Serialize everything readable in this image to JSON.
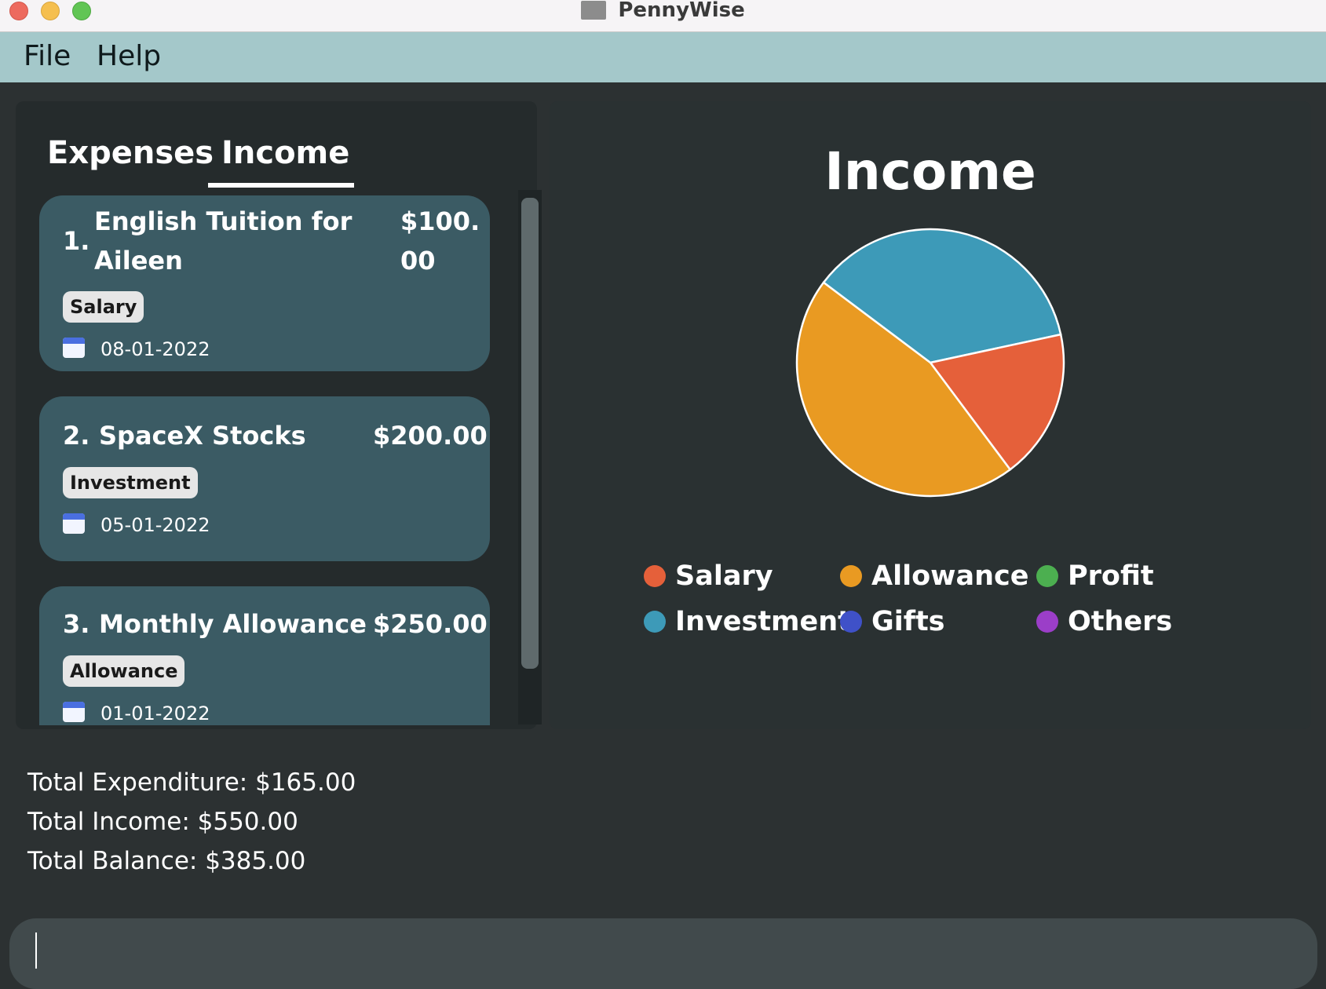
{
  "window": {
    "title": "PennyWise"
  },
  "menu": {
    "file": "File",
    "help": "Help"
  },
  "tabs": [
    {
      "label": "Expenses",
      "active": false
    },
    {
      "label": "Income",
      "active": true
    }
  ],
  "entries": [
    {
      "index": "1.",
      "description_line1": "English Tuition for",
      "description_line2": "Aileen",
      "amount_line1": "$100.",
      "amount_line2": "00",
      "category": "Salary",
      "date": "08-01-2022"
    },
    {
      "index": "2.",
      "description": "SpaceX Stocks",
      "amount": "$200.00",
      "category": "Investment",
      "date": "05-01-2022"
    },
    {
      "index": "3.",
      "description": "Monthly Allowance",
      "amount": "$250.00",
      "category": "Allowance",
      "date": "01-01-2022"
    }
  ],
  "chart_data": {
    "type": "pie",
    "title": "Income",
    "slices": [
      {
        "name": "Investment",
        "value": 200,
        "color": "#3d9ab8"
      },
      {
        "name": "Salary",
        "value": 100,
        "color": "#e5603a"
      },
      {
        "name": "Allowance",
        "value": 250,
        "color": "#e99a22"
      }
    ],
    "legend": [
      {
        "name": "Salary",
        "color": "#e5603a"
      },
      {
        "name": "Allowance",
        "color": "#e99a22"
      },
      {
        "name": "Profit",
        "color": "#4caf50"
      },
      {
        "name": "Investment",
        "color": "#3d9ab8"
      },
      {
        "name": "Gifts",
        "color": "#3f51c8"
      },
      {
        "name": "Others",
        "color": "#9b3ec8"
      }
    ]
  },
  "totals": {
    "expenditure": "Total Expenditure: $165.00",
    "income": "Total Income: $550.00",
    "balance": "Total Balance: $385.00"
  },
  "command": {
    "value": ""
  },
  "colors": {
    "background": "#2c3132",
    "menubar": "#a4c8ca",
    "card": "#3b5b64",
    "command_box": "#414a4c"
  }
}
